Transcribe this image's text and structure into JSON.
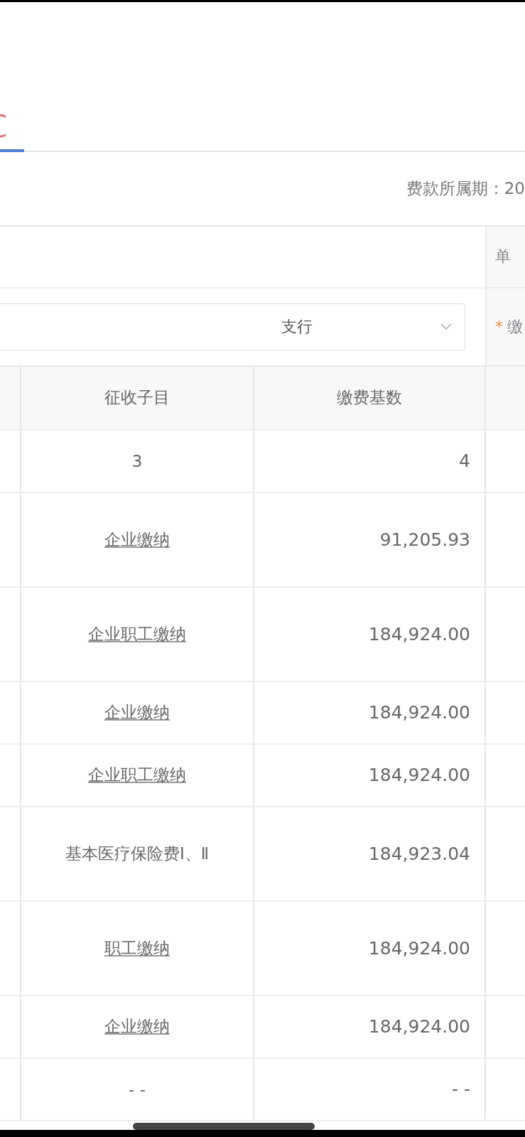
{
  "period_label": "费款所属期：20",
  "form": {
    "right_label": "单",
    "select": {
      "value": "支行"
    },
    "required_mark": "*",
    "required_label": "缴"
  },
  "table": {
    "columns": [
      "征收子目",
      "缴费基数"
    ],
    "index_row": [
      "3",
      "4"
    ],
    "rows": [
      {
        "item": "企业缴纳",
        "base": "91,205.93",
        "link": true
      },
      {
        "item": "企业职工缴纳",
        "base": "184,924.00",
        "link": true
      },
      {
        "item": "企业缴纳",
        "base": "184,924.00",
        "link": true
      },
      {
        "item": "企业职工缴纳",
        "base": "184,924.00",
        "link": true
      },
      {
        "item": "基本医疗保险费Ⅰ、Ⅱ",
        "base": "184,923.04",
        "link": false
      },
      {
        "item": "职工缴纳",
        "base": "184,924.00",
        "link": true
      },
      {
        "item": "企业缴纳",
        "base": "184,924.00",
        "link": true
      },
      {
        "item": "- -",
        "base": "- -",
        "link": false
      }
    ]
  }
}
